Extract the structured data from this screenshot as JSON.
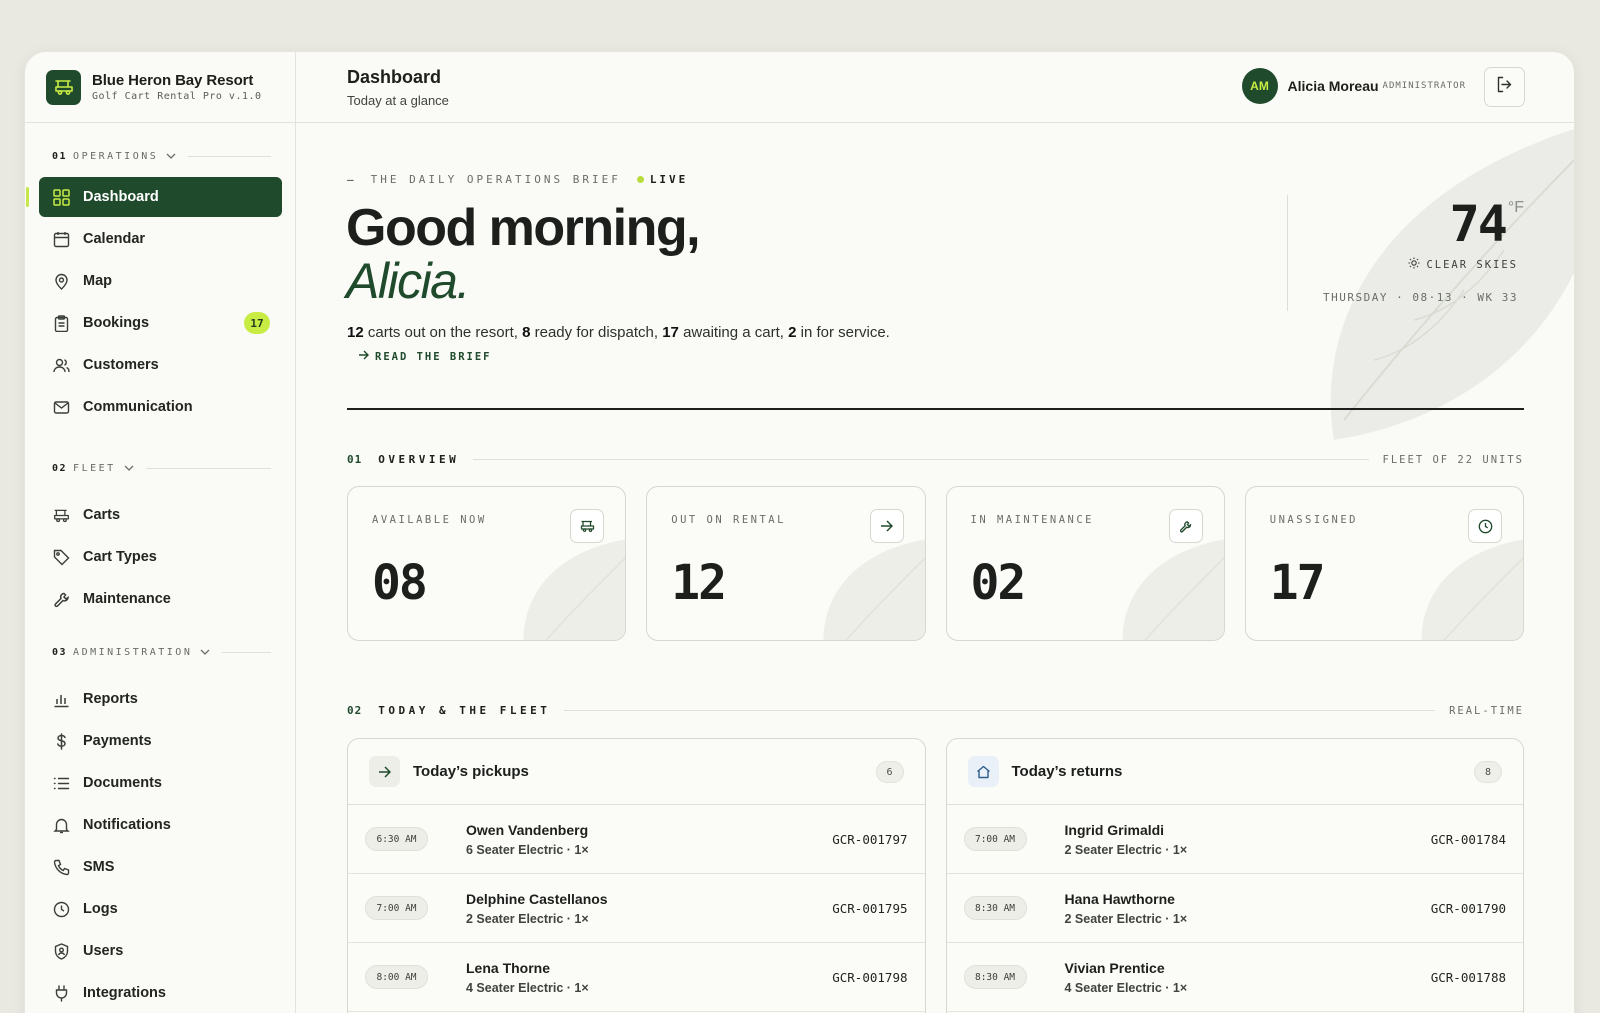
{
  "brand": {
    "name": "Blue Heron Bay Resort",
    "subtitle": "Golf Cart Rental Pro v.1.0"
  },
  "sidebar": {
    "sections": [
      {
        "num": "01",
        "label": "OPERATIONS"
      },
      {
        "num": "02",
        "label": "FLEET"
      },
      {
        "num": "03",
        "label": "ADMINISTRATION"
      }
    ],
    "items": [
      {
        "label": "Dashboard"
      },
      {
        "label": "Calendar"
      },
      {
        "label": "Map"
      },
      {
        "label": "Bookings",
        "badge": "17"
      },
      {
        "label": "Customers"
      },
      {
        "label": "Communication"
      },
      {
        "label": "Carts"
      },
      {
        "label": "Cart Types"
      },
      {
        "label": "Maintenance"
      },
      {
        "label": "Reports"
      },
      {
        "label": "Payments"
      },
      {
        "label": "Documents"
      },
      {
        "label": "Notifications"
      },
      {
        "label": "SMS"
      },
      {
        "label": "Logs"
      },
      {
        "label": "Users"
      },
      {
        "label": "Integrations"
      }
    ]
  },
  "header": {
    "title": "Dashboard",
    "subtitle": "Today at a glance",
    "user": {
      "initials": "AM",
      "name": "Alicia Moreau",
      "role": "ADMINISTRATOR"
    }
  },
  "hero": {
    "kicker": "THE DAILY OPERATIONS BRIEF",
    "live": "LIVE",
    "greeting": "Good morning,",
    "name": "Alicia.",
    "summary": {
      "out": "12",
      "out_text": "carts out on the resort,",
      "ready": "8",
      "ready_text": "ready for dispatch,",
      "awaiting": "17",
      "awaiting_text": "awaiting a cart,",
      "service": "2",
      "service_text": "in for service."
    },
    "brief_link": "READ THE BRIEF"
  },
  "weather": {
    "temp": "74",
    "unit": "°F",
    "condition": "CLEAR SKIES",
    "dateline": "THURSDAY · 08·13 · WK 33"
  },
  "overview": {
    "num": "01",
    "title": "OVERVIEW",
    "right": "FLEET OF 22 UNITS",
    "cards": [
      {
        "label": "AVAILABLE NOW",
        "value": "08",
        "icon": "cart-icon"
      },
      {
        "label": "OUT ON RENTAL",
        "value": "12",
        "icon": "arrow-right-icon"
      },
      {
        "label": "IN MAINTENANCE",
        "value": "02",
        "icon": "wrench-icon"
      },
      {
        "label": "UNASSIGNED",
        "value": "17",
        "icon": "clock-icon"
      }
    ]
  },
  "fleet": {
    "num": "02",
    "title": "TODAY & THE FLEET",
    "right": "REAL-TIME",
    "pickups": {
      "title": "Today’s pickups",
      "count": "6",
      "rows": [
        {
          "time": "6:30 AM",
          "name": "Owen Vandenberg",
          "detail": "6 Seater Electric · 1×",
          "code": "GCR-001797"
        },
        {
          "time": "7:00 AM",
          "name": "Delphine Castellanos",
          "detail": "2 Seater Electric · 1×",
          "code": "GCR-001795"
        },
        {
          "time": "8:00 AM",
          "name": "Lena Thorne",
          "detail": "4 Seater Electric · 1×",
          "code": "GCR-001798"
        }
      ]
    },
    "returns": {
      "title": "Today’s returns",
      "count": "8",
      "rows": [
        {
          "time": "7:00 AM",
          "name": "Ingrid Grimaldi",
          "detail": "2 Seater Electric · 1×",
          "code": "GCR-001784"
        },
        {
          "time": "8:30 AM",
          "name": "Hana Hawthorne",
          "detail": "2 Seater Electric · 1×",
          "code": "GCR-001790"
        },
        {
          "time": "8:30 AM",
          "name": "Vivian Prentice",
          "detail": "4 Seater Electric · 1×",
          "code": "GCR-001788"
        }
      ]
    }
  },
  "colors": {
    "brand_green": "#1f4a2c",
    "accent_lime": "#c9ec45",
    "background": "#fafaf7"
  }
}
